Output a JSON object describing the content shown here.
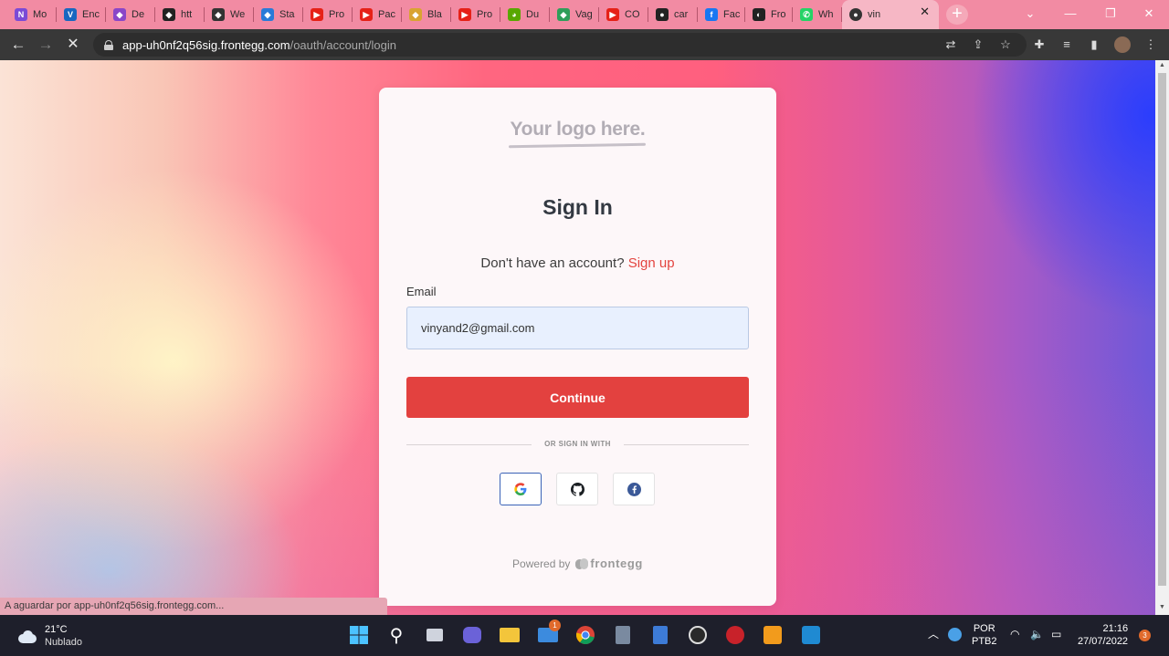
{
  "browser": {
    "tabs": [
      {
        "label": "Mo",
        "icon": "generic-site-icon",
        "color": "#7b4ad6"
      },
      {
        "label": "Enc",
        "icon": "vuetify-icon",
        "color": "#1867c0"
      },
      {
        "label": "De",
        "icon": "site-icon",
        "color": "#8a46c8"
      },
      {
        "label": "htt",
        "icon": "site-icon",
        "color": "#222222"
      },
      {
        "label": "We",
        "icon": "site-icon",
        "color": "#333333"
      },
      {
        "label": "Sta",
        "icon": "site-icon",
        "color": "#2a7ad8"
      },
      {
        "label": "Pro",
        "icon": "youtube-icon",
        "color": "#e62117"
      },
      {
        "label": "Pac",
        "icon": "youtube-icon",
        "color": "#e62117"
      },
      {
        "label": "Bla",
        "icon": "site-icon",
        "color": "#d9a431"
      },
      {
        "label": "Pro",
        "icon": "youtube-icon",
        "color": "#e62117"
      },
      {
        "label": "Du",
        "icon": "duolingo-icon",
        "color": "#58a700"
      },
      {
        "label": "Vag",
        "icon": "site-icon",
        "color": "#2f9e5a"
      },
      {
        "label": "CO",
        "icon": "youtube-icon",
        "color": "#e62117"
      },
      {
        "label": "car",
        "icon": "github-icon",
        "color": "#222222"
      },
      {
        "label": "Fac",
        "icon": "facebook-icon",
        "color": "#1877f2"
      },
      {
        "label": "Fro",
        "icon": "frontegg-icon",
        "color": "#222222"
      },
      {
        "label": "Wh",
        "icon": "whatsapp-icon",
        "color": "#25d366"
      },
      {
        "label": "vin",
        "icon": "github-icon",
        "color": "#222222"
      }
    ],
    "url_host": "app-uh0nf2q56sig.frontegg.com",
    "url_path": "/oauth/account/login",
    "status_text": "A aguardar por app-uh0nf2q56sig.frontegg.com..."
  },
  "login": {
    "logo_text": "Your logo here.",
    "title": "Sign In",
    "no_account_text": "Don't have an account?",
    "signup_link": "Sign up",
    "email_label": "Email",
    "email_value": "vinyand2@gmail.com",
    "continue_label": "Continue",
    "divider_text": "OR SIGN IN WITH",
    "powered_by": "Powered by",
    "brand": "frontegg",
    "accent_color": "#e3413f"
  },
  "taskbar": {
    "temperature": "21°C",
    "condition": "Nublado",
    "lang_top": "POR",
    "lang_bottom": "PTB2",
    "time": "21:16",
    "date": "27/07/2022",
    "notifications": "3",
    "mail_badge": "1"
  }
}
